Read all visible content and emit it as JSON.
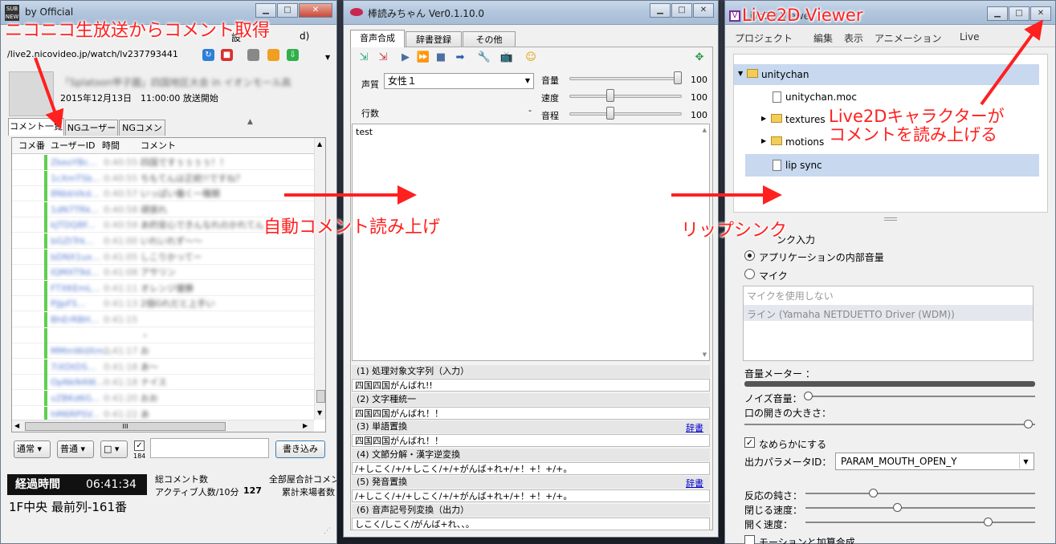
{
  "win1": {
    "title": "by Official",
    "url": "/live2.nicovideo.jp/watch/lv237793441",
    "partial_menu": "設",
    "partial_menu_right": "d)",
    "stream_title": "「Splatoon甲子園」四国地区大会 in イオンモール高",
    "start_time": "2015年12月13日　11:00:00 放送開始",
    "tabs": [
      "コメント一覧",
      "NGユーザー",
      "NGコメント"
    ],
    "columns": [
      "コメ番",
      "ユーザーID",
      "時間",
      "コメント"
    ],
    "rows": [
      {
        "user": "ZkeoYBc...",
        "time": "0:40:55",
        "comment": "四国ですぅぅぅぅ！！"
      },
      {
        "user": "1cXmTSb...",
        "time": "0:40:55",
        "comment": "ちもてんは正統!!ですね？"
      },
      {
        "user": "8NbbVkd...",
        "time": "0:40:57",
        "comment": "いっぱい働く一種類"
      },
      {
        "user": "1dN7TRk...",
        "time": "0:40:58",
        "comment": "頑張れ"
      },
      {
        "user": "kJTDQ8F...",
        "time": "0:40:59",
        "comment": "あ的安心できんなれのかれてん"
      },
      {
        "user": "bGZtTrk...",
        "time": "0:41:00",
        "comment": "いれいれず〜〜"
      },
      {
        "user": "bDNX1ux...",
        "time": "0:41:05",
        "comment": "しこりかってー"
      },
      {
        "user": "IQMXT9d...",
        "time": "0:41:08",
        "comment": "アサリン"
      },
      {
        "user": "FTXKEmL...",
        "time": "0:41:11",
        "comment": "オレンジ優勝"
      },
      {
        "user": "PjJpFS...",
        "time": "0:41:13",
        "comment": "2個Gれだと上手い"
      },
      {
        "user": "BhErRBH...",
        "time": "0:41:15",
        "comment": ""
      },
      {
        "user": "",
        "time": "",
        "comment": "・"
      },
      {
        "user": "MMmWdXm...",
        "time": "0:41:17",
        "comment": "お"
      },
      {
        "user": "7iXDtDS...",
        "time": "0:41:18",
        "comment": "あ〜"
      },
      {
        "user": "OpNkN4W...",
        "time": "0:41:18",
        "comment": "ナイス"
      },
      {
        "user": "vZBKd6G...",
        "time": "0:41:20",
        "comment": "おお"
      },
      {
        "user": "hM6RPSV...",
        "time": "0:41:22",
        "comment": "あ"
      }
    ],
    "scroll_mid": "III",
    "dropdown1": "通常",
    "dropdown2": "普通",
    "dropdown3": "□",
    "check_count": "184",
    "write_button": "書き込み",
    "elapsed_label": "経過時間",
    "elapsed_value": "06:41:34",
    "seat": "1F中央 最前列-161番",
    "total_comments": "総コメント数",
    "active_users": "アクティブ人数/10分",
    "active_count": "127",
    "all_rooms": "全部屋合計コメン",
    "total_visitors": "累計来場者数"
  },
  "win2": {
    "title": "棒読みちゃん Ver0.1.10.0",
    "tabs": [
      "音声合成",
      "辞書登録",
      "その他"
    ],
    "voice_label": "声質",
    "voice_value": "女性１",
    "volume_label": "音量",
    "speed_label": "速度",
    "pitch_label": "音程",
    "volume_value": "100",
    "speed_value": "100",
    "pitch_value": "100",
    "volume_level": 1.0,
    "speed_level": 0.35,
    "pitch_level": 0.35,
    "lines_label": "行数",
    "lines_dash": "-",
    "input_text": "test",
    "steps": [
      {
        "label": "(1) 処理対象文字列（入力）",
        "value": "四国四国がんばれ!!",
        "link": ""
      },
      {
        "label": "(2) 文字種統一",
        "value": "四国四国がんばれ！！",
        "link": ""
      },
      {
        "label": "(3) 単語置換",
        "value": "四国四国がんばれ！！",
        "link": "辞書"
      },
      {
        "label": "(4) 文節分解・漢字逆変換",
        "value": "/+しこく/+/+しこく/+/+がんば+れ+/+！+！+/+。",
        "link": ""
      },
      {
        "label": "(5) 発音置換",
        "value": "/+しこく/+/+しこく/+/+がんば+れ+/+！+！+/+。",
        "link": "辞書"
      },
      {
        "label": "(6) 音声記号列変換（出力）",
        "value": "しこく/しこく/がんば+れ、、。",
        "link": ""
      }
    ]
  },
  "win3": {
    "title": "Live2D Viewer",
    "menu": [
      "プロジェクト",
      "編集",
      "表示",
      "アニメーション",
      "Live"
    ],
    "tree_root": "unitychan",
    "tree_items": [
      "unitychan.moc",
      "textures",
      "motions",
      "lip sync"
    ],
    "lipsync_input_label": "ンク入力",
    "radio_app": "アプリケーションの内部音量",
    "radio_mic": "マイク",
    "mic_options": [
      "マイクを使用しない",
      "ライン (Yamaha NETDUETTO Driver (WDM))"
    ],
    "meter_label": "音量メーター ：",
    "noise_label": "ノイズ音量：",
    "mouth_label": "口の開きの大きさ：",
    "smooth_label": "なめらかにする",
    "param_label": "出力パラメータID：",
    "param_value": "PARAM_MOUTH_OPEN_Y",
    "reaction_label": "反応の鈍さ：",
    "close_label": "閉じる速度：",
    "open_label": "開く速度：",
    "motion_label": "モーションと加算合成",
    "noise_level": 0.0,
    "mouth_level": 1.0,
    "reaction_level": 0.3,
    "close_speed_level": 0.41,
    "open_speed_level": 0.82
  },
  "annotations": {
    "nico": "ニコニコ生放送からコメント取得",
    "auto_read": "自動コメント読み上げ",
    "lipsync": "リップシンク",
    "live2d": "Live2Dキャラクターが\nコメントを読み上げる"
  },
  "colors": {
    "annotation_red": "#ff2020",
    "selection_blue": "#c7d8ef",
    "green_bar": "#5fcf4f"
  }
}
